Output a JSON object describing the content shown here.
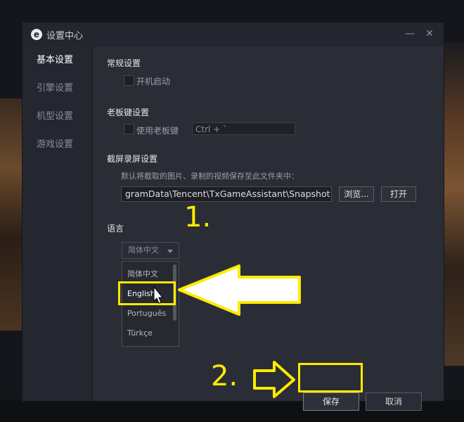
{
  "window": {
    "title": "设置中心",
    "minimize_label": "—",
    "close_label": "✕"
  },
  "sidebar": {
    "items": [
      {
        "label": "基本设置",
        "active": true
      },
      {
        "label": "引擎设置",
        "active": false
      },
      {
        "label": "机型设置",
        "active": false
      },
      {
        "label": "游戏设置",
        "active": false
      }
    ]
  },
  "general": {
    "title": "常规设置",
    "autostart_label": "开机启动",
    "autostart_checked": false
  },
  "boss_key": {
    "title": "老板键设置",
    "enable_label": "使用老板键",
    "enabled": false,
    "hotkey_value": "Ctrl + `"
  },
  "screenshot": {
    "title": "截屏录屏设置",
    "hint": "默认将截取的图片、录制的视频保存至此文件夹中：",
    "path_value": "gramData\\Tencent\\TxGameAssistant\\Snapshot",
    "browse_label": "浏览...",
    "open_label": "打开"
  },
  "language": {
    "title": "语言",
    "selected": "简体中文",
    "options": [
      "简体中文",
      "English",
      "Português",
      "Türkçe"
    ],
    "hovered_option": "English"
  },
  "footer": {
    "save_label": "保存",
    "cancel_label": "取消"
  },
  "annotations": {
    "step1": "1.",
    "step2": "2.",
    "color": "#ffea00"
  },
  "colors": {
    "window_bg": "#2a2d36",
    "sidebar_bg": "#24272f",
    "titlebar_bg": "#23262e",
    "annotation": "#ffea00"
  }
}
